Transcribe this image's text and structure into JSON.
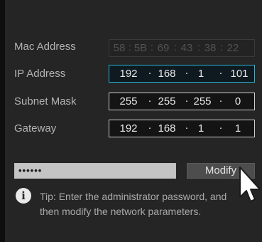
{
  "network": {
    "mac": {
      "label": "Mac Address",
      "parts": [
        "58",
        "5B",
        "69",
        "43",
        "38",
        "22"
      ]
    },
    "ip": {
      "label": "IP Address",
      "parts": [
        "192",
        "168",
        "1",
        "101"
      ]
    },
    "subnet": {
      "label": "Subnet Mask",
      "parts": [
        "255",
        "255",
        "255",
        "0"
      ]
    },
    "gateway": {
      "label": "Gateway",
      "parts": [
        "192",
        "168",
        "1",
        "1"
      ]
    }
  },
  "password": {
    "value": "••••••"
  },
  "modify_button": {
    "label": "Modify"
  },
  "tip": {
    "line1": "Tip: Enter the administrator password, and",
    "line2": "then modify the network parameters."
  },
  "colors": {
    "background": "#252525",
    "focus_border": "#29b6d8",
    "field_border": "#cfcfcf",
    "button_bg": "#4d4d4d"
  },
  "icons": {
    "info": "info-icon",
    "cursor": "mouse-pointer-icon"
  }
}
